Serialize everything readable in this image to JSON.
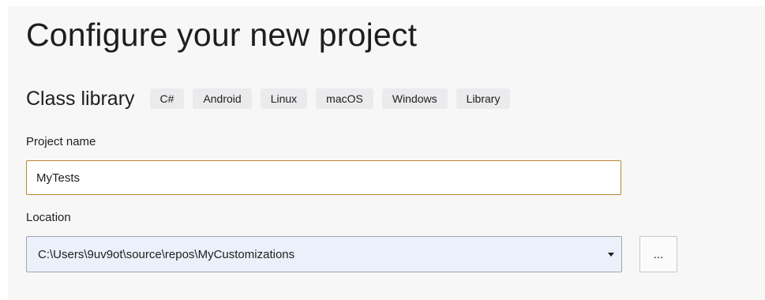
{
  "page": {
    "title": "Configure your new project"
  },
  "template": {
    "name": "Class library",
    "tags": [
      "C#",
      "Android",
      "Linux",
      "macOS",
      "Windows",
      "Library"
    ]
  },
  "project_name": {
    "label": "Project name",
    "value": "MyTests"
  },
  "location": {
    "label": "Location",
    "value": "C:\\Users\\9uv9ot\\source\\repos\\MyCustomizations",
    "dropdown_icon": "chevron-down-icon",
    "browse_label": "..."
  },
  "colors": {
    "focus_border": "#b8892e",
    "combo_background": "#eaf1fb",
    "tag_background": "#ebebed",
    "panel_background": "#f7f7f8"
  }
}
